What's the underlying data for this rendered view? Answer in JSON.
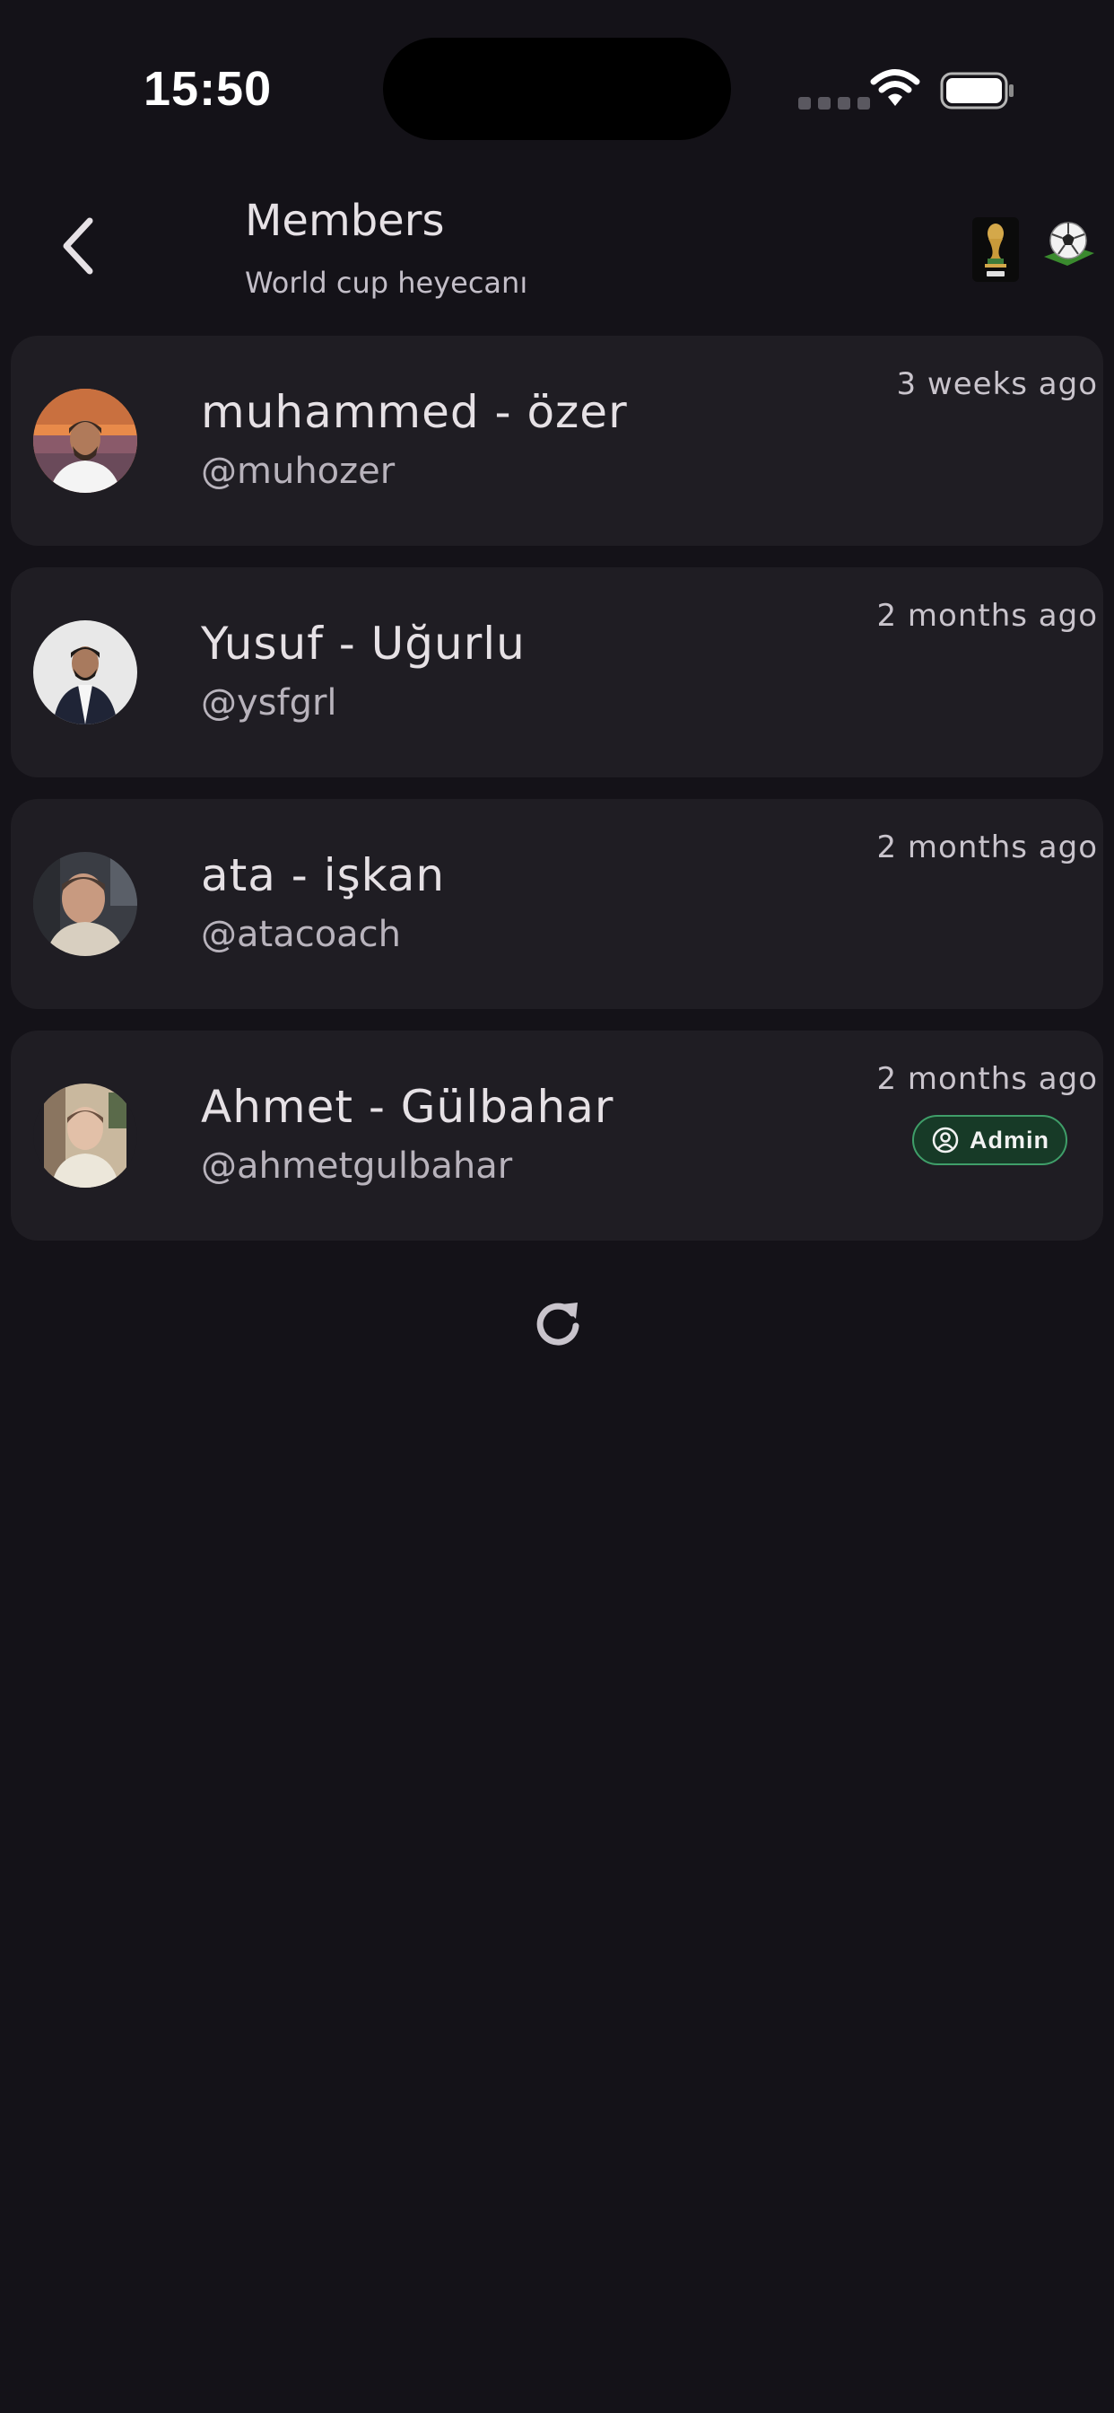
{
  "status_bar": {
    "time": "15:50"
  },
  "header": {
    "title": "Members",
    "subtitle": "World cup heyecanı",
    "icons": [
      "back-chevron-icon",
      "world-cup-trophy-icon",
      "soccer-ball-icon"
    ]
  },
  "members": [
    {
      "name": "muhammed - özer",
      "handle": "@muhozer",
      "joined": "3 weeks ago",
      "is_admin": false
    },
    {
      "name": "Yusuf - Uğurlu",
      "handle": "@ysfgrl",
      "joined": "2 months ago",
      "is_admin": false
    },
    {
      "name": "ata - işkan",
      "handle": "@atacoach",
      "joined": "2 months ago",
      "is_admin": false
    },
    {
      "name": "Ahmet - Gülbahar",
      "handle": "@ahmetgulbahar",
      "joined": "2 months ago",
      "is_admin": true,
      "badge_label": "Admin"
    }
  ],
  "actions": {
    "refresh_icon": "refresh-icon"
  },
  "colors": {
    "background": "#141218",
    "card": "#1f1d23",
    "admin_badge_border": "#3f9e69",
    "admin_badge_fill": "#173a27"
  }
}
